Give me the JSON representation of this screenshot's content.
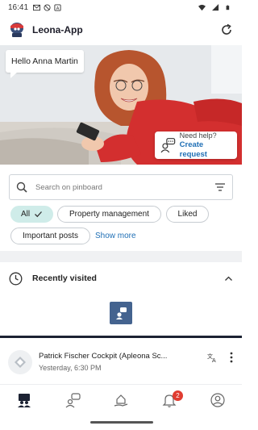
{
  "status_bar": {
    "time": "16:41"
  },
  "app": {
    "title": "Leona-App"
  },
  "hero": {
    "greeting": "Hello Anna Martin",
    "help_question": "Need help?",
    "help_link": "Create request"
  },
  "search": {
    "placeholder": "Search on pinboard"
  },
  "filters": {
    "chips": [
      {
        "label": "All",
        "selected": true
      },
      {
        "label": "Property management",
        "selected": false
      },
      {
        "label": "Liked",
        "selected": false
      },
      {
        "label": "Important posts",
        "selected": false
      }
    ],
    "show_more": "Show more"
  },
  "recently_visited": {
    "title": "Recently visited"
  },
  "post": {
    "author": "Patrick Fischer Cockpit (Apleona Sc...",
    "time": "Yesterday, 6:30 PM"
  },
  "bottom_nav": {
    "items": [
      {
        "icon": "pinboard-icon",
        "active": true
      },
      {
        "icon": "chat-person-icon"
      },
      {
        "icon": "house-hand-icon"
      },
      {
        "icon": "bell-icon",
        "badge": "2"
      },
      {
        "icon": "profile-icon"
      }
    ]
  },
  "colors": {
    "accent": "#1f6fb5",
    "chip_active": "#cfece9",
    "badge": "#e03c31",
    "nav_dark": "#1c2233"
  }
}
